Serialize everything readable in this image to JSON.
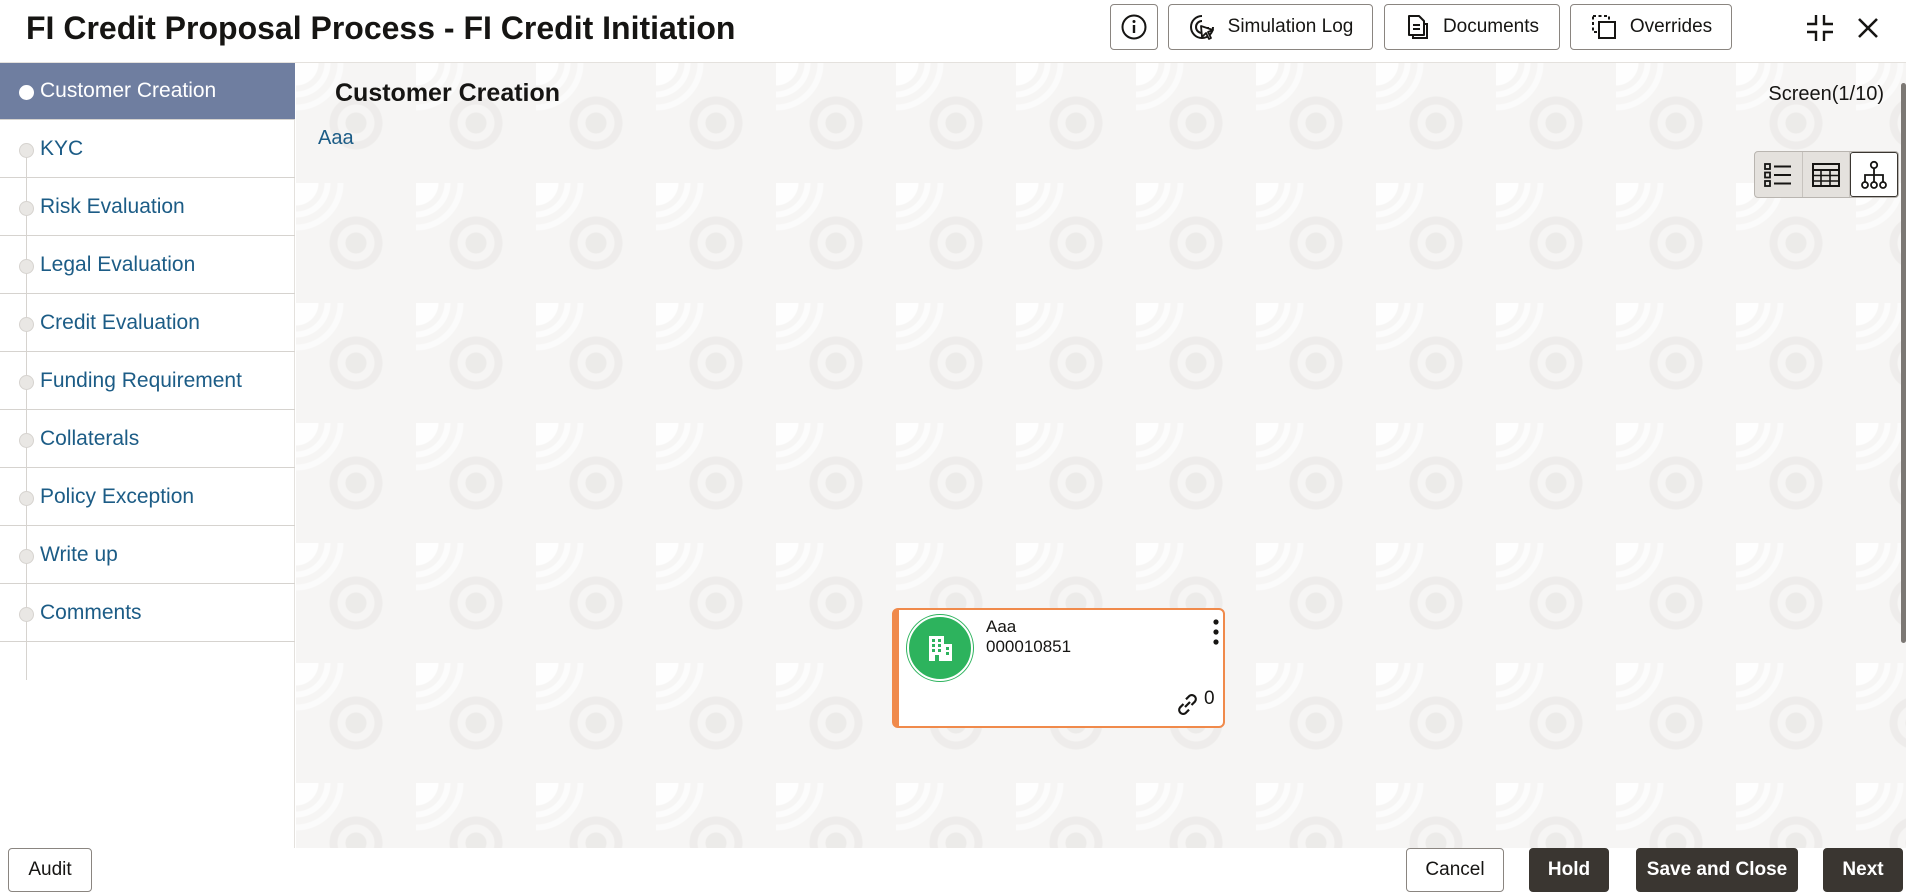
{
  "header": {
    "title": "FI Credit Proposal Process - FI Credit Initiation",
    "info_icon": "info-icon",
    "simulation_log_label": "Simulation Log",
    "documents_label": "Documents",
    "overrides_label": "Overrides",
    "compress_icon": "compress-icon",
    "close_icon": "close-icon"
  },
  "sidebar": {
    "items": [
      {
        "label": "Customer Creation",
        "active": true
      },
      {
        "label": "KYC"
      },
      {
        "label": "Risk Evaluation"
      },
      {
        "label": "Legal Evaluation"
      },
      {
        "label": "Credit Evaluation"
      },
      {
        "label": "Funding Requirement"
      },
      {
        "label": "Collaterals"
      },
      {
        "label": "Policy Exception"
      },
      {
        "label": "Write up"
      },
      {
        "label": "Comments"
      }
    ]
  },
  "main": {
    "title": "Customer Creation",
    "screen_counter": "Screen(1/10)",
    "breadcrumb": "Aaa",
    "view_toggle": [
      "list-view-icon",
      "table-view-icon",
      "hierarchy-view-icon"
    ],
    "selected_view": "hierarchy-view-icon",
    "card": {
      "name": "Aaa",
      "id": "000010851",
      "link_count": "0",
      "accent_color": "#f08a4b",
      "avatar_color": "#2db35d",
      "avatar_icon": "building-icon"
    }
  },
  "footer": {
    "audit_label": "Audit",
    "cancel_label": "Cancel",
    "hold_label": "Hold",
    "save_close_label": "Save and Close",
    "next_label": "Next"
  },
  "colors": {
    "active_step": "#6f7ea0",
    "link_text": "#1c5c86",
    "dark_button": "#3a3631"
  }
}
